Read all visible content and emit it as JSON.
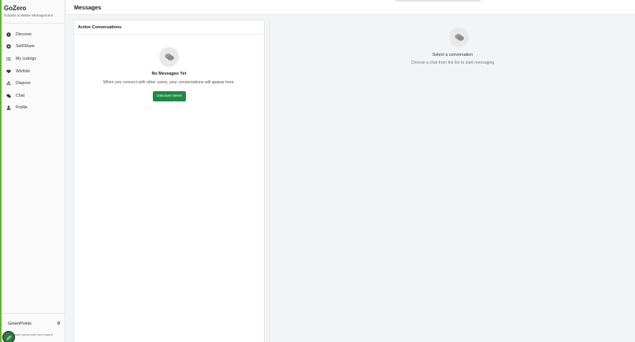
{
  "brand": {
    "title": "GoZero",
    "subtitle": "Surplus & Waste Management"
  },
  "nav": [
    {
      "label": "Discover",
      "icon": "compass-icon"
    },
    {
      "label": "Sell/Share",
      "icon": "tag-icon"
    },
    {
      "label": "My Listings",
      "icon": "list-icon"
    },
    {
      "label": "Wishlist",
      "icon": "heart-icon"
    },
    {
      "label": "Dispose",
      "icon": "recycle-icon"
    },
    {
      "label": "Chat",
      "icon": "chat-icon"
    },
    {
      "label": "Profile",
      "icon": "user-icon"
    }
  ],
  "greenpoints": {
    "label": "GreenPoints",
    "value": "0",
    "note": "more points until next reward"
  },
  "header": {
    "title": "Messages"
  },
  "conversations": {
    "title": "Active Conversations",
    "empty_title": "No Messages Yet",
    "empty_text": "When you connect with other users, your conversations will appear here.",
    "button_label": "Discover Items"
  },
  "detail": {
    "title": "Select a conversation",
    "text": "Choose a chat from the list to start messaging"
  },
  "colors": {
    "accent": "#5fb832",
    "button": "#1e8a45"
  }
}
